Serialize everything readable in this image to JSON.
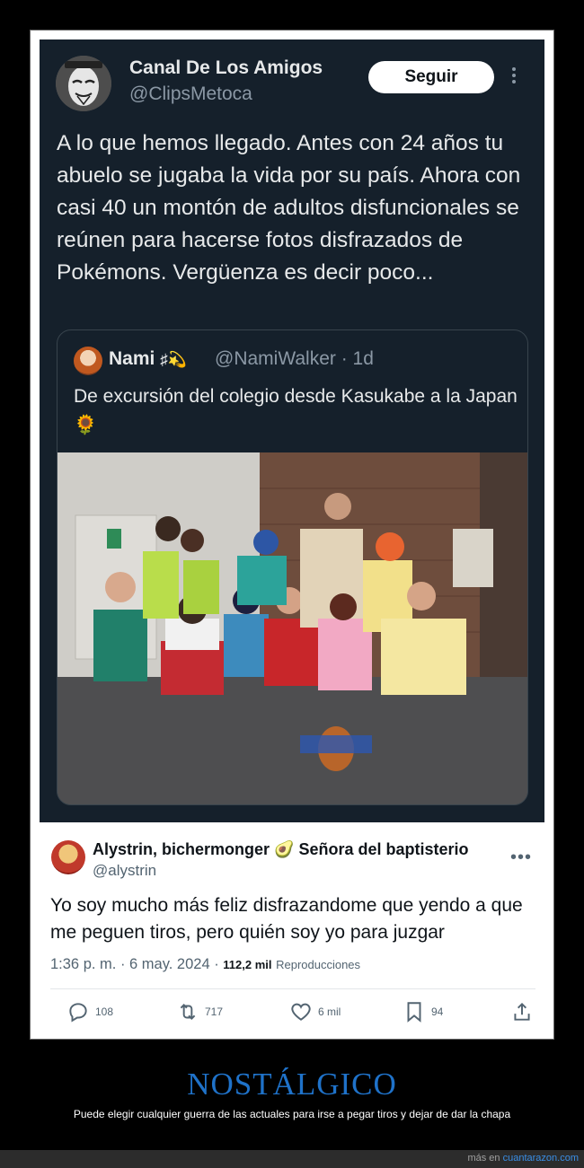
{
  "tweet": {
    "name": "Canal De Los Amigos",
    "handle": "@ClipsMetoca",
    "follow_label": "Seguir",
    "text": "A lo que hemos llegado. Antes con 24 años tu abuelo se jugaba la vida por su país. Ahora con casi 40 un montón de adultos disfuncionales se reúnen para hacerse fotos disfrazados de Pokémons. Vergüenza es decir poco...",
    "avatar_icon": "anonymous-mask-icon"
  },
  "quote": {
    "name": "Nami 🏴‍☠️💫",
    "name_text": "Nami",
    "emoji": "♯💫",
    "handle_time": "@NamiWalker · 1d",
    "text": "De excursión del colegio desde Kasukabe a la Japan 🌻"
  },
  "reply": {
    "name": "Alystrin, bichermonger 🥑 Señora del baptisterio",
    "handle": "@alystrin",
    "text": "Yo soy mucho más feliz disfrazandome que yendo a que me peguen tiros, pero quién soy yo para juzgar",
    "time": "1:36 p. m. · 6 may. 2024 · ",
    "views_count": "112,2 mil",
    "views_label": "Reproducciones",
    "actions": {
      "replies": "108",
      "retweets": "717",
      "likes": "6 mil",
      "bookmarks": "94"
    }
  },
  "footer": {
    "title": "NOSTÁLGICO",
    "subtitle": "Puede elegir cualquier guerra de las actuales para irse a pegar tiros y dejar de dar la chapa",
    "more_prefix": "más en ",
    "site": "cuantarazon.com"
  },
  "colors": {
    "dark_bg": "#15202b",
    "title_blue": "#1f72c9",
    "link_blue": "#3a8ee6"
  }
}
